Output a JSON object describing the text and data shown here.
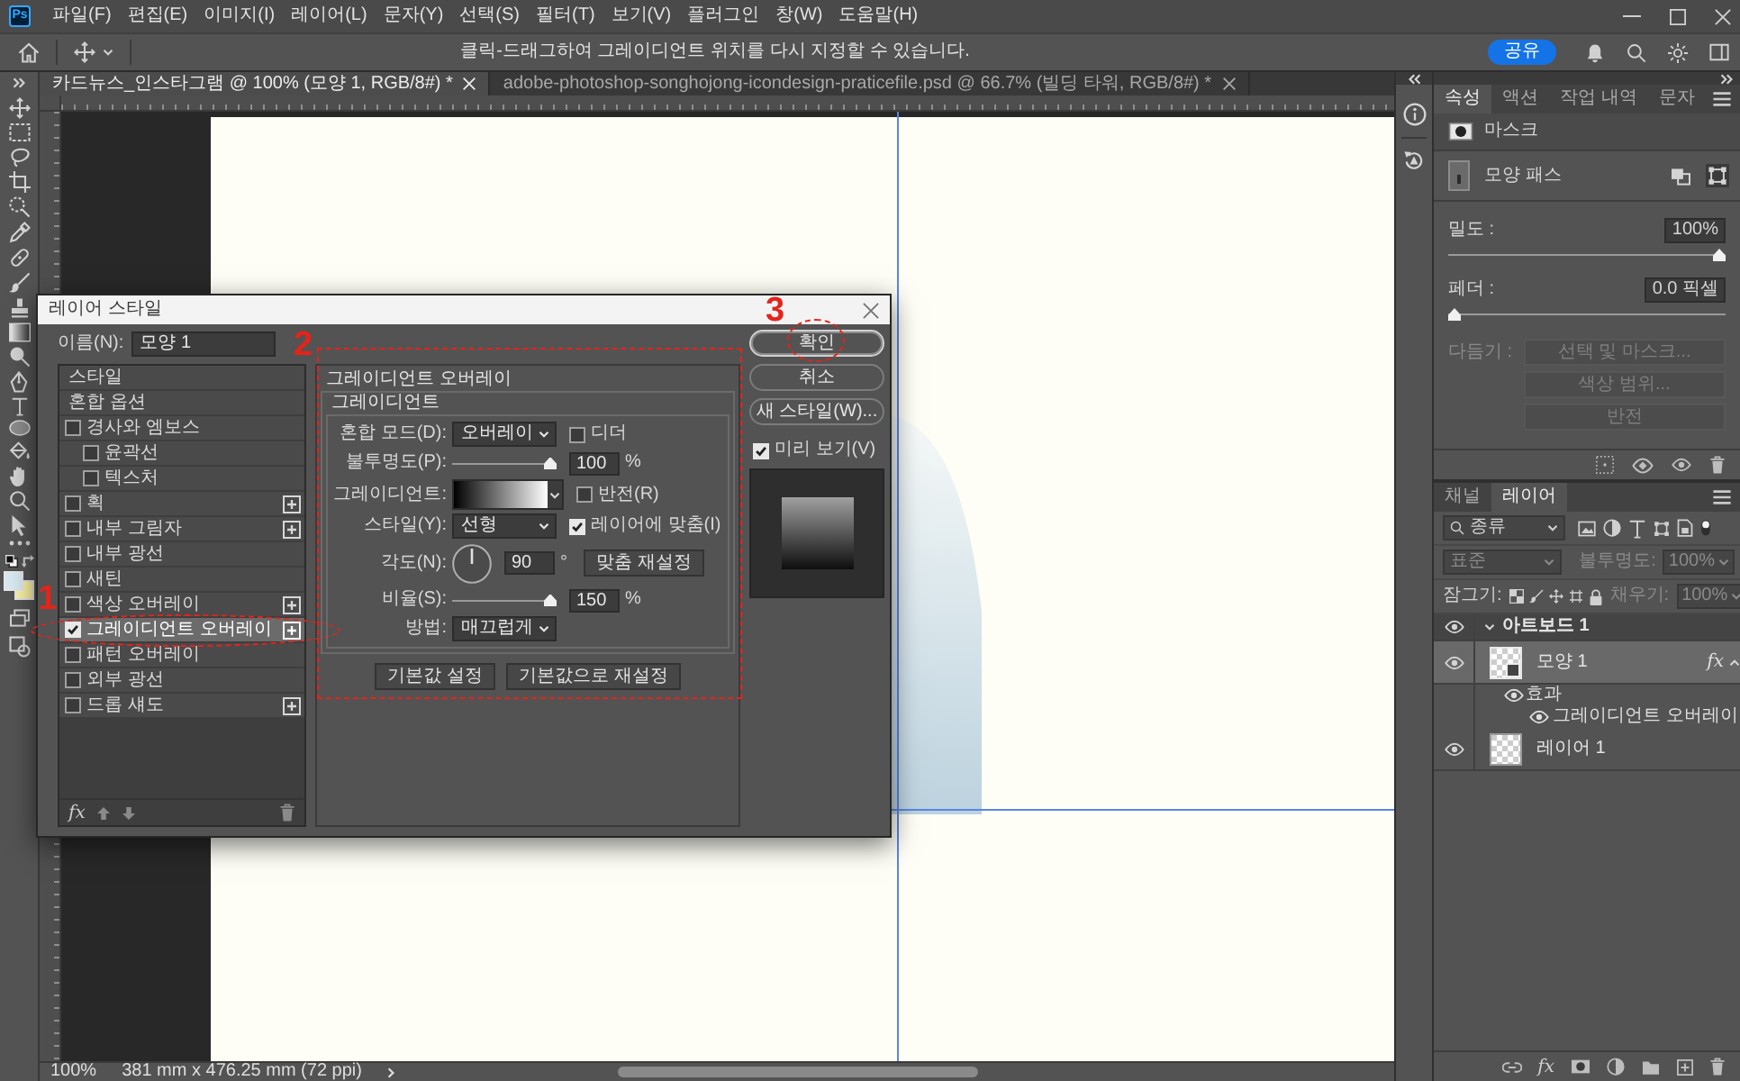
{
  "menu_bar": {
    "logo": "Ps",
    "items": [
      "파일(F)",
      "편집(E)",
      "이미지(I)",
      "레이어(L)",
      "문자(Y)",
      "선택(S)",
      "필터(T)",
      "보기(V)",
      "플러그인",
      "창(W)",
      "도움말(H)"
    ]
  },
  "options_bar": {
    "hint": "클릭-드래그하여 그레이디언트 위치를 다시 지정할 수 있습니다.",
    "share_button": "공유"
  },
  "document_tabs": [
    {
      "label": "카드뉴스_인스타그램 @ 100% (모양 1, RGB/8#) *",
      "selected": true
    },
    {
      "label": "adobe-photoshop-songhojong-icondesign-praticefile.psd @ 66.7% (빌딩 타워, RGB/8#) *",
      "selected": false
    }
  ],
  "status_bar": {
    "zoom": "100%",
    "doc_size": "381 mm x 476.25 mm (72 ppi)"
  },
  "layer_style_dialog": {
    "title": "레이어 스타일",
    "name": {
      "label": "이름(N):",
      "value": "모양 1"
    },
    "styles": [
      {
        "kind": "header",
        "label": "스타일",
        "selected": false
      },
      {
        "kind": "header",
        "label": "혼합 옵션",
        "selected": false
      },
      {
        "kind": "check",
        "label": "경사와 엠보스",
        "checked": false,
        "selected": false,
        "children": [
          {
            "kind": "check",
            "label": "윤곽선",
            "checked": false,
            "selected": false
          },
          {
            "kind": "check",
            "label": "텍스처",
            "checked": false,
            "selected": false
          }
        ]
      },
      {
        "kind": "check",
        "label": "획",
        "checked": false,
        "addable": true,
        "selected": false
      },
      {
        "kind": "check",
        "label": "내부 그림자",
        "checked": false,
        "addable": true,
        "selected": false
      },
      {
        "kind": "check",
        "label": "내부 광선",
        "checked": false,
        "selected": false
      },
      {
        "kind": "check",
        "label": "새틴",
        "checked": false,
        "selected": false
      },
      {
        "kind": "check",
        "label": "색상 오버레이",
        "checked": false,
        "addable": true,
        "selected": false
      },
      {
        "kind": "check",
        "label": "그레이디언트 오버레이",
        "checked": true,
        "addable": true,
        "selected": true
      },
      {
        "kind": "check",
        "label": "패턴 오버레이",
        "checked": false,
        "selected": false
      },
      {
        "kind": "check",
        "label": "외부 광선",
        "checked": false,
        "selected": false
      },
      {
        "kind": "check",
        "label": "드롭 섀도",
        "checked": false,
        "addable": true,
        "selected": false
      }
    ],
    "list_footer_fx": "fx",
    "section_title": "그레이디언트 오버레이",
    "group_title": "그레이디언트",
    "blend_mode": {
      "label": "혼합 모드(D):",
      "value": "오버레이"
    },
    "dither": {
      "label": "디더",
      "checked": false
    },
    "opacity": {
      "label": "불투명도(P):",
      "level": 1,
      "value": "100",
      "unit": "%"
    },
    "gradient": {
      "label": "그레이디언트:"
    },
    "reverse": {
      "label": "반전(R)",
      "checked": false
    },
    "style": {
      "label": "스타일(Y):",
      "value": "선형"
    },
    "align_with_layer": {
      "label": "레이어에 맞춤(I)",
      "checked": true
    },
    "angle": {
      "label": "각도(N):",
      "value": "90",
      "unit": "°"
    },
    "reset_alignment_button": "맞춤 재설정",
    "scale": {
      "label": "비율(S):",
      "level": 1,
      "value": "150",
      "unit": "%"
    },
    "method": {
      "label": "방법:",
      "value": "매끄럽게"
    },
    "default_buttons": [
      "기본값 설정",
      "기본값으로 재설정"
    ],
    "action_buttons": [
      {
        "label": "확인",
        "default": true
      },
      {
        "label": "취소",
        "default": false
      },
      {
        "label": "새 스타일(W)...",
        "default": false
      }
    ],
    "preview": {
      "label": "미리 보기(V)",
      "checked": true
    },
    "annotations": [
      "1",
      "2",
      "3"
    ]
  },
  "properties_panel": {
    "tabs": [
      {
        "label": "속성",
        "selected": true
      },
      {
        "label": "액션",
        "selected": false
      },
      {
        "label": "작업 내역",
        "selected": false
      },
      {
        "label": "문자",
        "selected": false
      }
    ],
    "mask_title": "마스크",
    "shape_path": "모양 패스",
    "density": {
      "label": "밀도 :",
      "value": "100%",
      "level": 1
    },
    "feather": {
      "label": "페더 :",
      "value": "0.0 픽셀",
      "level": 0
    },
    "refine": {
      "label": "다듬기 :",
      "disabled": true
    },
    "refine_buttons": [
      {
        "label": "선택 및 마스크...",
        "disabled": true
      },
      {
        "label": "색상 범위...",
        "disabled": true
      },
      {
        "label": "반전",
        "disabled": true
      }
    ]
  },
  "layers_panel": {
    "tabs": [
      {
        "label": "채널",
        "selected": false
      },
      {
        "label": "레이어",
        "selected": true
      }
    ],
    "filter": {
      "value": "종류"
    },
    "blend_mode": {
      "value": "표준",
      "disabled": true
    },
    "opacity": {
      "label": "불투명도:",
      "value": "100%",
      "disabled": true
    },
    "lock": {
      "label": "잠그기:"
    },
    "fill": {
      "label": "채우기:",
      "value": "100%",
      "disabled": true
    },
    "layers": [
      {
        "kind": "artboard",
        "name": "아트보드 1",
        "visible": true,
        "expanded": true,
        "selected": false,
        "children": [
          {
            "kind": "shape",
            "name": "모양 1",
            "visible": true,
            "selected": true,
            "fx_badge": "fx",
            "effects_expanded": true,
            "effects": {
              "label": "효과",
              "visible": true,
              "items": [
                {
                  "name": "그레이디언트 오버레이",
                  "visible": true
                }
              ]
            }
          },
          {
            "kind": "pixel",
            "name": "레이어 1",
            "visible": true,
            "selected": false
          }
        ]
      }
    ],
    "footer_fx": "fx"
  }
}
